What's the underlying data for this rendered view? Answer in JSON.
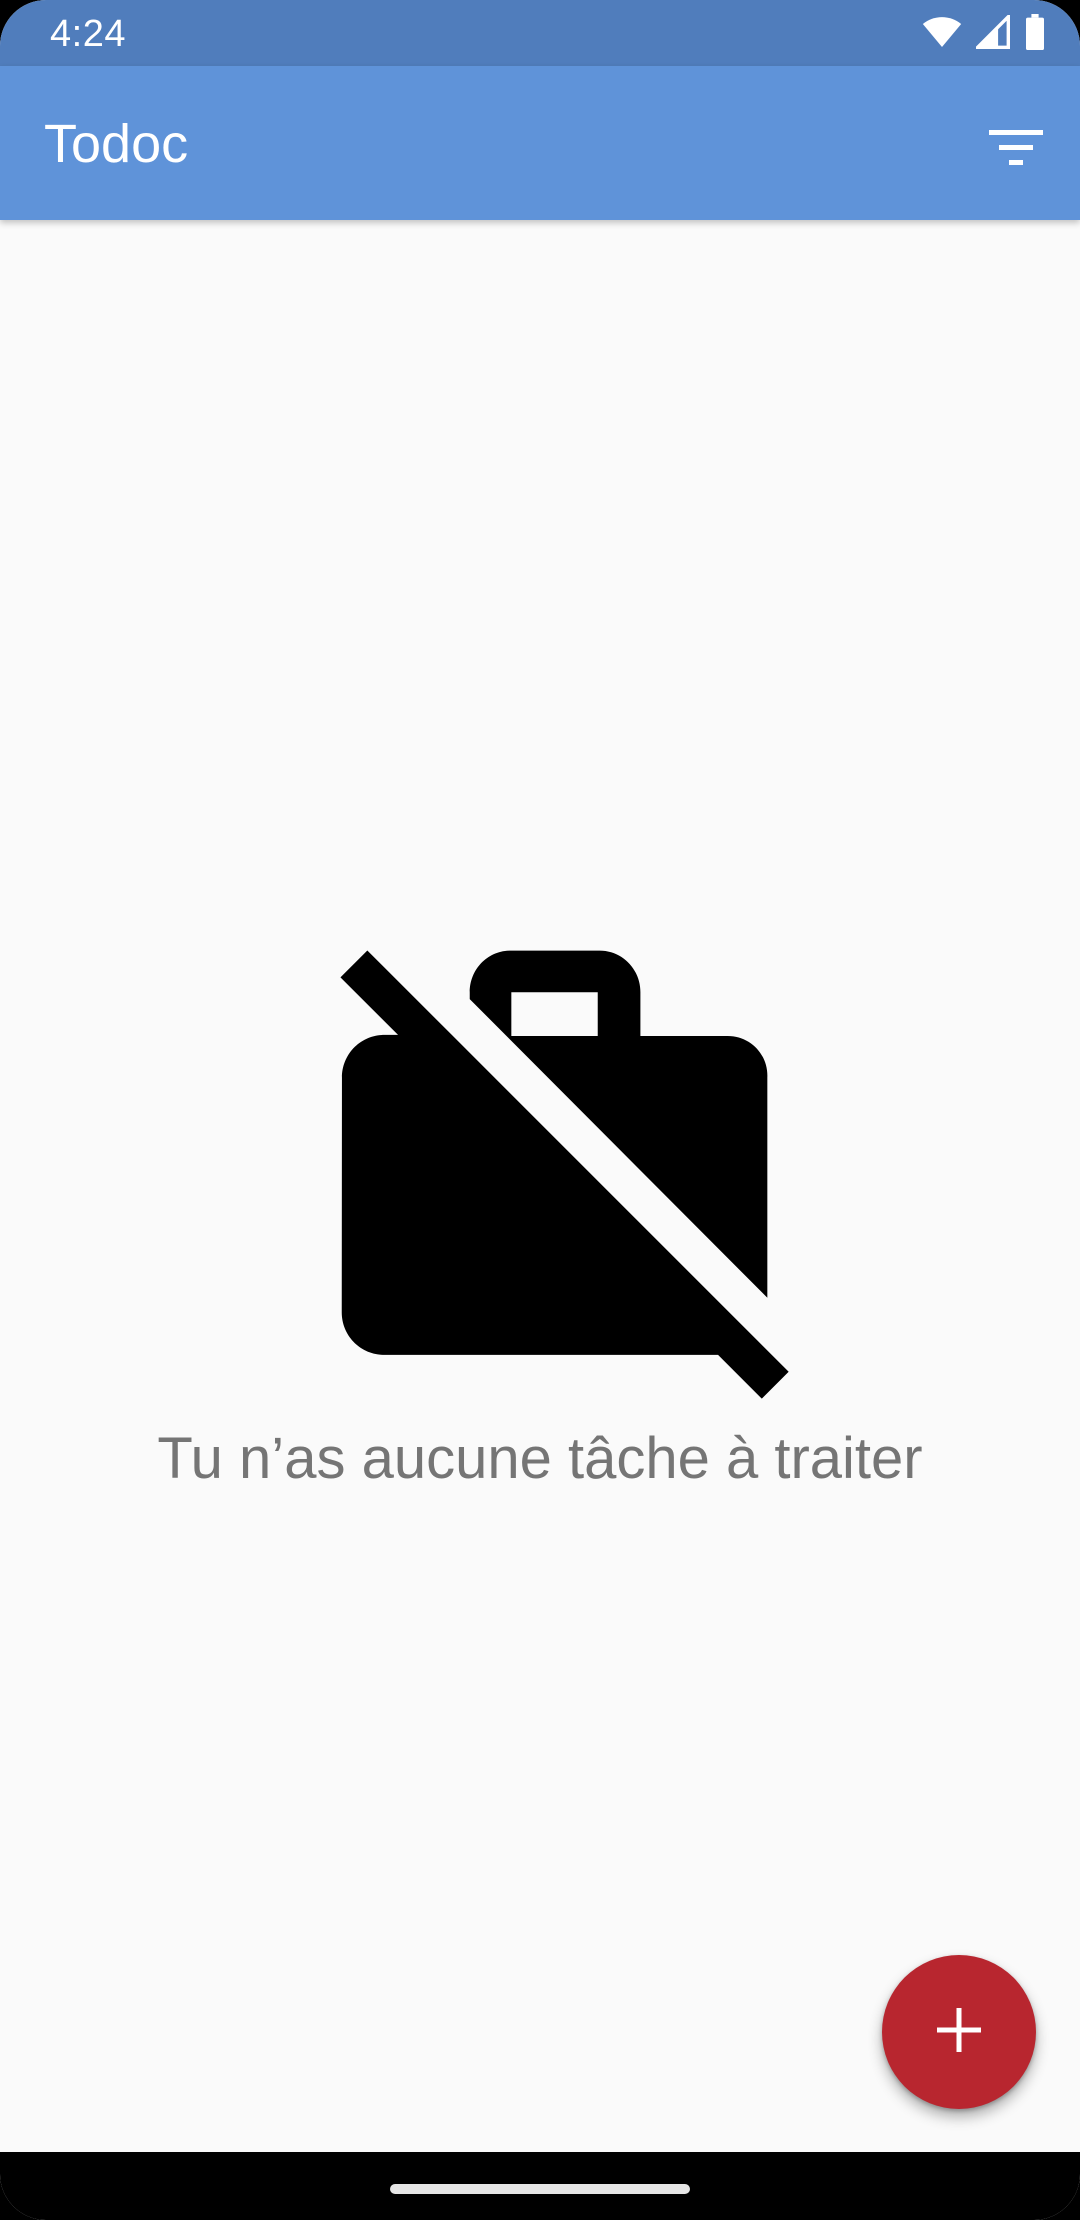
{
  "status_bar": {
    "time": "4:24",
    "icons": [
      "wifi-icon",
      "cell-signal-icon",
      "battery-icon"
    ]
  },
  "app_bar": {
    "title": "Todoc",
    "sort_icon": "filter-list-icon"
  },
  "empty_state": {
    "icon": "work-off-icon",
    "message": "Tu n’as aucune tâche à traiter"
  },
  "fab": {
    "icon": "add-icon"
  },
  "colors": {
    "status_bar": "#507dbc",
    "app_bar": "#5f93d9",
    "background": "#fafafa",
    "fab": "#b8262f",
    "empty_text": "#757575"
  }
}
